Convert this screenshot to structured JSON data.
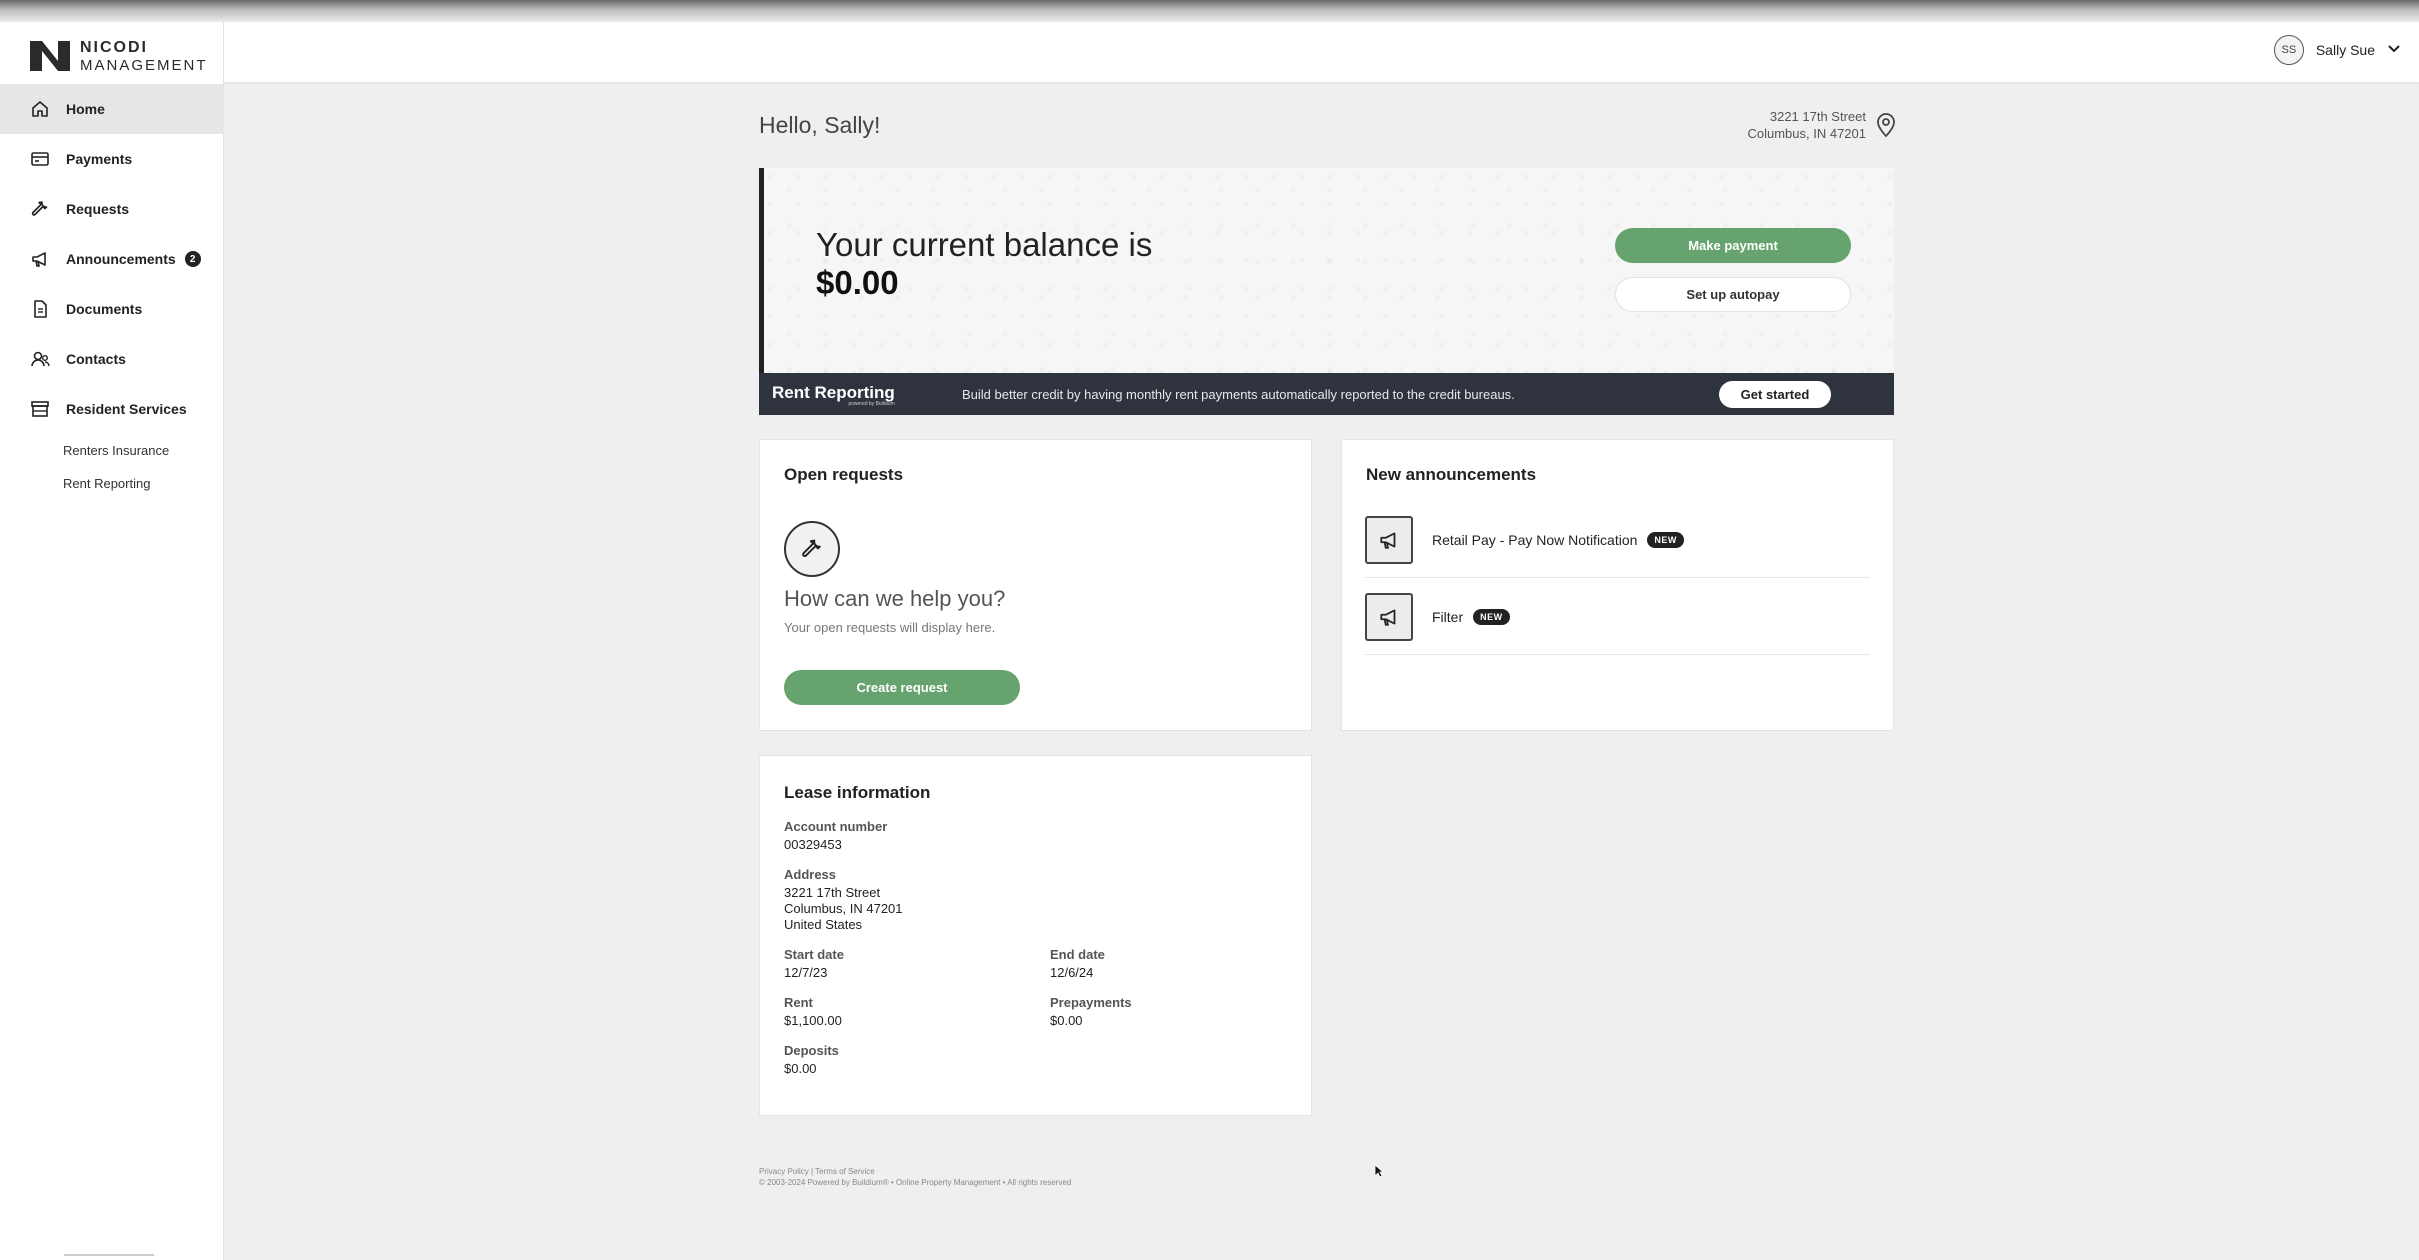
{
  "brand": {
    "line1": "NICODI",
    "line2": "MANAGEMENT"
  },
  "sidebar": {
    "items": [
      {
        "label": "Home",
        "icon": "home-icon"
      },
      {
        "label": "Payments",
        "icon": "card-icon"
      },
      {
        "label": "Requests",
        "icon": "wrench-icon"
      },
      {
        "label": "Announcements",
        "icon": "megaphone-icon",
        "badge": "2"
      },
      {
        "label": "Documents",
        "icon": "document-icon"
      },
      {
        "label": "Contacts",
        "icon": "contacts-icon"
      },
      {
        "label": "Resident Services",
        "icon": "services-icon"
      }
    ],
    "sub_items": [
      "Renters Insurance",
      "Rent Reporting"
    ]
  },
  "header": {
    "avatar_initials": "SS",
    "user_name": "Sally Sue"
  },
  "main": {
    "greeting": "Hello, Sally!",
    "address_line1": "3221 17th Street",
    "address_line2": "Columbus, IN 47201"
  },
  "balance": {
    "label": "Your current balance is",
    "amount": "$0.00",
    "make_payment": "Make payment",
    "autopay": "Set up autopay"
  },
  "rent_reporting": {
    "title": "Rent Reporting",
    "powered": "powered by Buildium",
    "text": "Build better credit by having monthly rent payments automatically reported to the credit bureaus.",
    "button": "Get started"
  },
  "open_requests": {
    "title": "Open requests",
    "headline": "How can we help you?",
    "subtext": "Your open requests will display here.",
    "button": "Create request"
  },
  "announcements": {
    "title": "New announcements",
    "items": [
      {
        "title": "Retail Pay - Pay Now Notification",
        "badge": "NEW"
      },
      {
        "title": "Filter",
        "badge": "NEW"
      }
    ]
  },
  "lease": {
    "title": "Lease information",
    "account_label": "Account number",
    "account_value": "00329453",
    "address_label": "Address",
    "address_line1": "3221 17th Street",
    "address_line2": "Columbus, IN 47201",
    "address_line3": "United States",
    "start_label": "Start date",
    "start_value": "12/7/23",
    "end_label": "End date",
    "end_value": "12/6/24",
    "rent_label": "Rent",
    "rent_value": "$1,100.00",
    "prepay_label": "Prepayments",
    "prepay_value": "$0.00",
    "deposits_label": "Deposits",
    "deposits_value": "$0.00"
  },
  "footer": {
    "links": "Privacy Policy | Terms of Service",
    "copyright": "© 2003-2024 Powered by Buildium® • Online Property Management • All rights reserved"
  }
}
